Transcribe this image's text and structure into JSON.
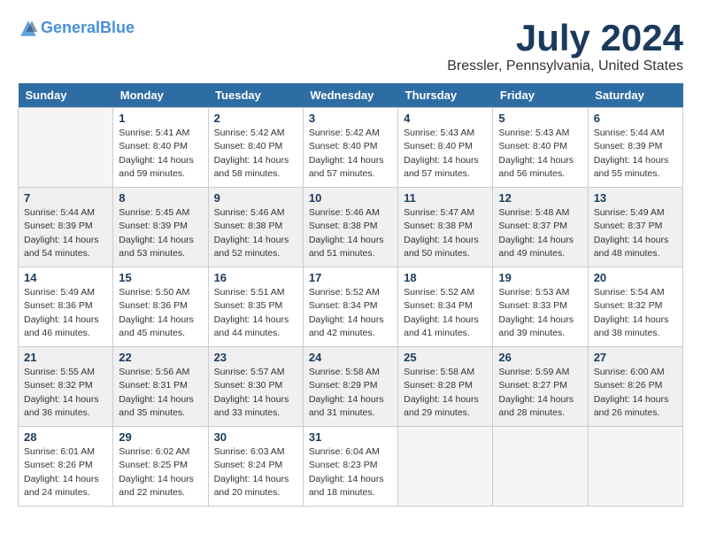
{
  "logo": {
    "line1": "General",
    "line2": "Blue"
  },
  "title": "July 2024",
  "location": "Bressler, Pennsylvania, United States",
  "days_of_week": [
    "Sunday",
    "Monday",
    "Tuesday",
    "Wednesday",
    "Thursday",
    "Friday",
    "Saturday"
  ],
  "weeks": [
    [
      {
        "day": "",
        "info": ""
      },
      {
        "day": "1",
        "info": "Sunrise: 5:41 AM\nSunset: 8:40 PM\nDaylight: 14 hours\nand 59 minutes."
      },
      {
        "day": "2",
        "info": "Sunrise: 5:42 AM\nSunset: 8:40 PM\nDaylight: 14 hours\nand 58 minutes."
      },
      {
        "day": "3",
        "info": "Sunrise: 5:42 AM\nSunset: 8:40 PM\nDaylight: 14 hours\nand 57 minutes."
      },
      {
        "day": "4",
        "info": "Sunrise: 5:43 AM\nSunset: 8:40 PM\nDaylight: 14 hours\nand 57 minutes."
      },
      {
        "day": "5",
        "info": "Sunrise: 5:43 AM\nSunset: 8:40 PM\nDaylight: 14 hours\nand 56 minutes."
      },
      {
        "day": "6",
        "info": "Sunrise: 5:44 AM\nSunset: 8:39 PM\nDaylight: 14 hours\nand 55 minutes."
      }
    ],
    [
      {
        "day": "7",
        "info": "Sunrise: 5:44 AM\nSunset: 8:39 PM\nDaylight: 14 hours\nand 54 minutes."
      },
      {
        "day": "8",
        "info": "Sunrise: 5:45 AM\nSunset: 8:39 PM\nDaylight: 14 hours\nand 53 minutes."
      },
      {
        "day": "9",
        "info": "Sunrise: 5:46 AM\nSunset: 8:38 PM\nDaylight: 14 hours\nand 52 minutes."
      },
      {
        "day": "10",
        "info": "Sunrise: 5:46 AM\nSunset: 8:38 PM\nDaylight: 14 hours\nand 51 minutes."
      },
      {
        "day": "11",
        "info": "Sunrise: 5:47 AM\nSunset: 8:38 PM\nDaylight: 14 hours\nand 50 minutes."
      },
      {
        "day": "12",
        "info": "Sunrise: 5:48 AM\nSunset: 8:37 PM\nDaylight: 14 hours\nand 49 minutes."
      },
      {
        "day": "13",
        "info": "Sunrise: 5:49 AM\nSunset: 8:37 PM\nDaylight: 14 hours\nand 48 minutes."
      }
    ],
    [
      {
        "day": "14",
        "info": "Sunrise: 5:49 AM\nSunset: 8:36 PM\nDaylight: 14 hours\nand 46 minutes."
      },
      {
        "day": "15",
        "info": "Sunrise: 5:50 AM\nSunset: 8:36 PM\nDaylight: 14 hours\nand 45 minutes."
      },
      {
        "day": "16",
        "info": "Sunrise: 5:51 AM\nSunset: 8:35 PM\nDaylight: 14 hours\nand 44 minutes."
      },
      {
        "day": "17",
        "info": "Sunrise: 5:52 AM\nSunset: 8:34 PM\nDaylight: 14 hours\nand 42 minutes."
      },
      {
        "day": "18",
        "info": "Sunrise: 5:52 AM\nSunset: 8:34 PM\nDaylight: 14 hours\nand 41 minutes."
      },
      {
        "day": "19",
        "info": "Sunrise: 5:53 AM\nSunset: 8:33 PM\nDaylight: 14 hours\nand 39 minutes."
      },
      {
        "day": "20",
        "info": "Sunrise: 5:54 AM\nSunset: 8:32 PM\nDaylight: 14 hours\nand 38 minutes."
      }
    ],
    [
      {
        "day": "21",
        "info": "Sunrise: 5:55 AM\nSunset: 8:32 PM\nDaylight: 14 hours\nand 36 minutes."
      },
      {
        "day": "22",
        "info": "Sunrise: 5:56 AM\nSunset: 8:31 PM\nDaylight: 14 hours\nand 35 minutes."
      },
      {
        "day": "23",
        "info": "Sunrise: 5:57 AM\nSunset: 8:30 PM\nDaylight: 14 hours\nand 33 minutes."
      },
      {
        "day": "24",
        "info": "Sunrise: 5:58 AM\nSunset: 8:29 PM\nDaylight: 14 hours\nand 31 minutes."
      },
      {
        "day": "25",
        "info": "Sunrise: 5:58 AM\nSunset: 8:28 PM\nDaylight: 14 hours\nand 29 minutes."
      },
      {
        "day": "26",
        "info": "Sunrise: 5:59 AM\nSunset: 8:27 PM\nDaylight: 14 hours\nand 28 minutes."
      },
      {
        "day": "27",
        "info": "Sunrise: 6:00 AM\nSunset: 8:26 PM\nDaylight: 14 hours\nand 26 minutes."
      }
    ],
    [
      {
        "day": "28",
        "info": "Sunrise: 6:01 AM\nSunset: 8:26 PM\nDaylight: 14 hours\nand 24 minutes."
      },
      {
        "day": "29",
        "info": "Sunrise: 6:02 AM\nSunset: 8:25 PM\nDaylight: 14 hours\nand 22 minutes."
      },
      {
        "day": "30",
        "info": "Sunrise: 6:03 AM\nSunset: 8:24 PM\nDaylight: 14 hours\nand 20 minutes."
      },
      {
        "day": "31",
        "info": "Sunrise: 6:04 AM\nSunset: 8:23 PM\nDaylight: 14 hours\nand 18 minutes."
      },
      {
        "day": "",
        "info": ""
      },
      {
        "day": "",
        "info": ""
      },
      {
        "day": "",
        "info": ""
      }
    ]
  ]
}
